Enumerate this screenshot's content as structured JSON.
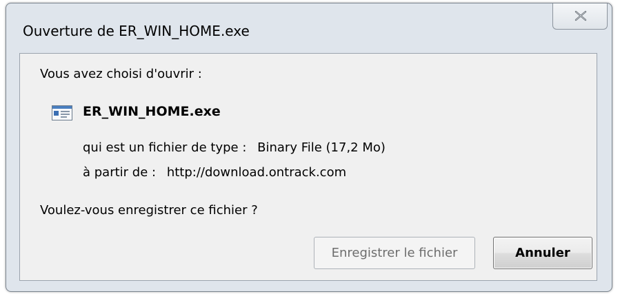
{
  "window": {
    "title": "Ouverture de ER_WIN_HOME.exe"
  },
  "dialog": {
    "intro": "Vous avez choisi d'ouvrir :",
    "file_name": "ER_WIN_HOME.exe",
    "file_icon": "executable-file-icon",
    "type_label": "qui est un fichier de type :",
    "type_value": "Binary File (17,2 Mo)",
    "source_label": "à partir de :",
    "source_value": "http://download.ontrack.com",
    "question": "Voulez-vous enregistrer ce fichier ?"
  },
  "buttons": {
    "save_label": "Enregistrer le fichier",
    "cancel_label": "Annuler"
  },
  "colors": {
    "frame": "#dfe5ec",
    "client": "#f0f0f0",
    "disabled_text": "#6d6d6d"
  }
}
